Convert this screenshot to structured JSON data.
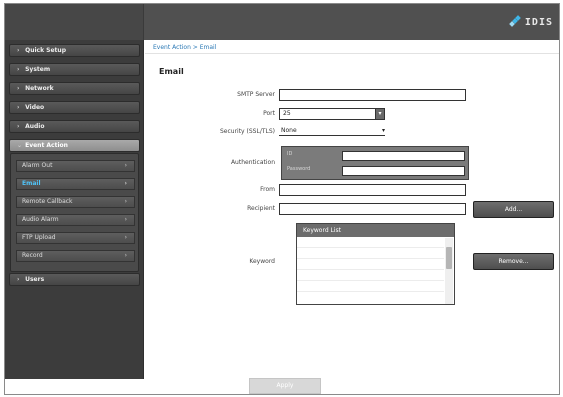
{
  "header": {
    "logo_text": "IDIS"
  },
  "sidebar": {
    "items": [
      {
        "label": "Quick Setup"
      },
      {
        "label": "System"
      },
      {
        "label": "Network"
      },
      {
        "label": "Video"
      },
      {
        "label": "Audio"
      },
      {
        "label": "Event Action"
      },
      {
        "label": "Users"
      }
    ],
    "submenu": [
      {
        "label": "Alarm Out"
      },
      {
        "label": "Email"
      },
      {
        "label": "Remote Callback"
      },
      {
        "label": "Audio Alarm"
      },
      {
        "label": "FTP Upload"
      },
      {
        "label": "Record"
      }
    ],
    "active_index": 5,
    "selected_sub_index": 1
  },
  "breadcrumb": "Event Action > Email",
  "page_title": "Email",
  "form": {
    "smtp_server_label": "SMTP Server",
    "port_label": "Port",
    "port_value": "25",
    "security_label": "Security (SSL/TLS)",
    "security_value": "None",
    "authentication_label": "Authentication",
    "auth_id_label": "ID",
    "auth_password_label": "Password",
    "from_label": "From",
    "recipient_label": "Recipient",
    "keyword_label": "Keyword",
    "keyword_list_header": "Keyword List",
    "add_button": "Add...",
    "remove_button": "Remove..."
  },
  "apply_button": "Apply"
}
